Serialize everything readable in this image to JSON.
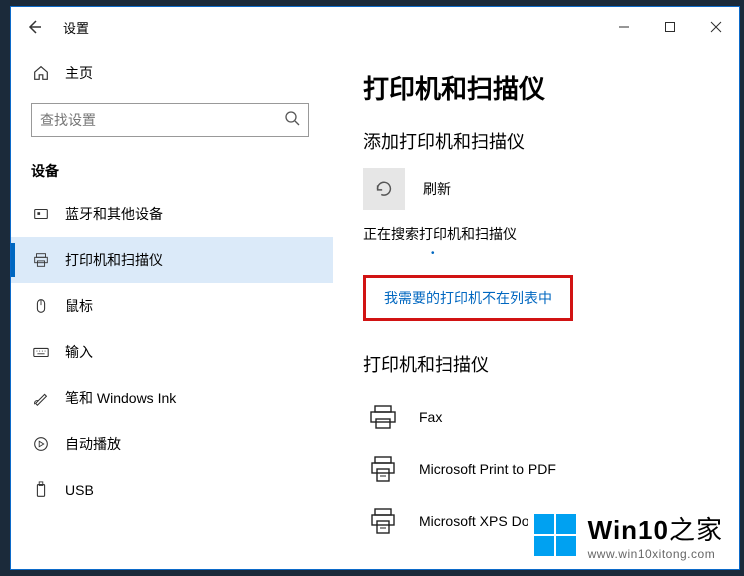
{
  "titlebar": {
    "title": "设置"
  },
  "sidebar": {
    "home": "主页",
    "search_placeholder": "查找设置",
    "group": "设备",
    "items": [
      {
        "label": "蓝牙和其他设备"
      },
      {
        "label": "打印机和扫描仪"
      },
      {
        "label": "鼠标"
      },
      {
        "label": "输入"
      },
      {
        "label": "笔和 Windows Ink"
      },
      {
        "label": "自动播放"
      },
      {
        "label": "USB"
      }
    ]
  },
  "main": {
    "h1": "打印机和扫描仪",
    "add_heading": "添加打印机和扫描仪",
    "refresh_label": "刷新",
    "status": "正在搜索打印机和扫描仪",
    "not_listed": "我需要的打印机不在列表中",
    "list_heading": "打印机和扫描仪",
    "printers": [
      {
        "name": "Fax"
      },
      {
        "name": "Microsoft Print to PDF"
      },
      {
        "name": "Microsoft XPS Do"
      }
    ]
  },
  "watermark": {
    "brand_bold": "Win10",
    "brand_rest": "之家",
    "url": "www.win10xitong.com"
  }
}
